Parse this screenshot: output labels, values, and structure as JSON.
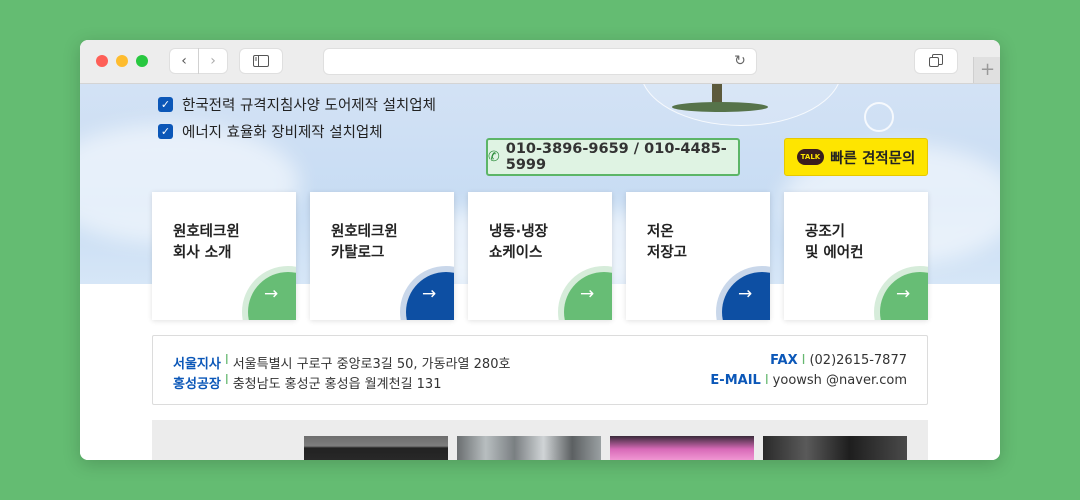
{
  "browser": {
    "url": "",
    "back_icon": "‹",
    "forward_icon": "›",
    "reload_icon": "↻",
    "new_tab_icon": "+"
  },
  "hero": {
    "checks": [
      {
        "label": "한국전력 규격지침사양 도어제작 설치업체"
      },
      {
        "label": "에너지 효율화 장비제작 설치업체"
      }
    ],
    "phone_button": {
      "icon": "phone-icon",
      "label": "010-3896-9659 / 010-4485-5999"
    },
    "kakao_button": {
      "icon_text": "TALK",
      "label": "빠른 견적문의"
    }
  },
  "cards": [
    {
      "line1": "원호테크윈",
      "line2": "회사 소개",
      "accent": "green"
    },
    {
      "line1": "원호테크윈",
      "line2": "카탈로그",
      "accent": "blue"
    },
    {
      "line1": "냉동·냉장",
      "line2": "쇼케이스",
      "accent": "green"
    },
    {
      "line1": "저온",
      "line2": "저장고",
      "accent": "blue"
    },
    {
      "line1": "공조기",
      "line2": "및 에어컨",
      "accent": "green"
    }
  ],
  "info": {
    "seoul": {
      "label": "서울지사",
      "address": "서울특별시 구로구 중앙로3길 50, 가동라열 280호"
    },
    "hongseong": {
      "label": "홍성공장",
      "address": "충청남도 홍성군 홍성읍 월계천길 131"
    },
    "fax": {
      "label": "FAX",
      "value": "(02)2615-7877"
    },
    "email": {
      "label": "E-MAIL",
      "value": "yoowsh @naver.com"
    },
    "separator": "I"
  },
  "colors": {
    "brand_blue": "#0b57b8",
    "brand_green": "#67bd75",
    "kakao_yellow": "#fee500"
  }
}
